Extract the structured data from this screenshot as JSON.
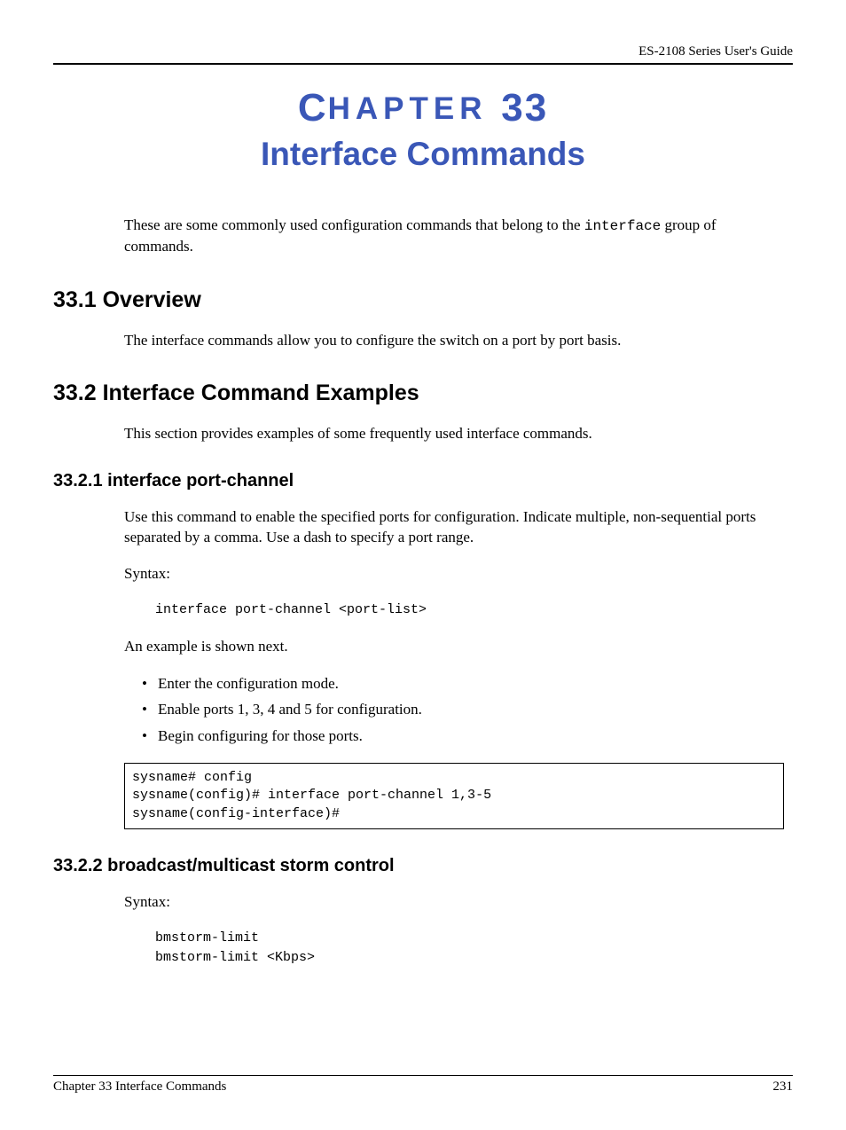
{
  "header": {
    "guide_title": "ES-2108 Series User's Guide"
  },
  "chapter": {
    "label_prefix": "HAPTER",
    "number": "33",
    "title": "Interface Commands",
    "intro_before_code": "These are some commonly used configuration commands that belong to the ",
    "intro_code": "interface",
    "intro_after_code": " group of commands."
  },
  "sections": {
    "s1": {
      "heading": "33.1  Overview",
      "body": "The interface commands allow you to configure the switch on a port by port basis."
    },
    "s2": {
      "heading": "33.2  Interface Command Examples",
      "body": "This section provides examples of some frequently used interface commands."
    },
    "s2_1": {
      "heading": "33.2.1  interface port-channel",
      "body": "Use this command to enable the specified ports for configuration. Indicate multiple, non-sequential ports separated by a comma. Use a dash to specify a port range.",
      "syntax_label": "Syntax:",
      "syntax_code": "interface port-channel <port-list>",
      "example_intro": "An example is shown next.",
      "bullets": [
        "Enter the configuration mode.",
        "Enable ports 1, 3, 4 and 5 for configuration.",
        "Begin configuring for those ports."
      ],
      "code_box": "sysname# config\nsysname(config)# interface port-channel 1,3-5\nsysname(config-interface)#"
    },
    "s2_2": {
      "heading": "33.2.2  broadcast/multicast storm control",
      "syntax_label": "Syntax:",
      "syntax_code": "bmstorm-limit\nbmstorm-limit <Kbps>"
    }
  },
  "footer": {
    "left": "Chapter 33 Interface Commands",
    "right": "231"
  }
}
